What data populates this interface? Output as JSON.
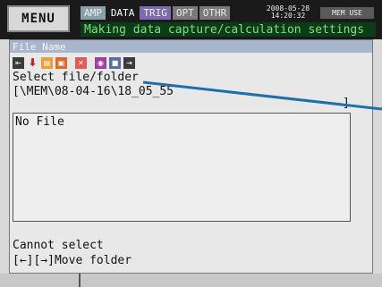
{
  "header": {
    "menu_label": "MENU",
    "tabs": [
      {
        "label": "AMP"
      },
      {
        "label": "DATA"
      },
      {
        "label": "TRIG"
      },
      {
        "label": "OPT"
      },
      {
        "label": "OTHR"
      }
    ],
    "date": "2008-05-28",
    "time": "14:20:32",
    "mem_badge": "MEM USE",
    "status_message": "Making data capture/calculation settings"
  },
  "panel": {
    "title": "File Name",
    "prompt": "Select file/folder",
    "path": "[\\MEM\\08-04-16\\18_05_55",
    "path_close": "]",
    "empty_message": "No File",
    "help_line_1": "Cannot select",
    "help_line_2": "[←][→]Move folder"
  },
  "icons": {
    "back": "⇤",
    "download": "⬇",
    "folder": "▤",
    "save": "▣",
    "delete": "✕",
    "tag": "◉",
    "file": "■",
    "forward": "⇥"
  },
  "colors": {
    "status_bg": "#0c3b18",
    "status_text": "#7ee07e",
    "panel_title_bg": "#a7b6cc",
    "pointer_line": "#1f6fa8"
  }
}
